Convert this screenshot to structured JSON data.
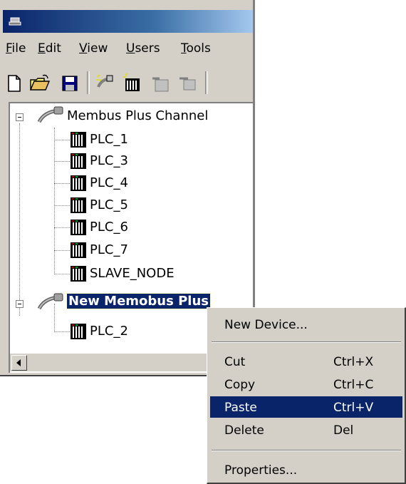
{
  "menubar": {
    "items": [
      {
        "label": "File",
        "mnemonic": "F",
        "rest": "ile"
      },
      {
        "label": "Edit",
        "mnemonic": "E",
        "rest": "dit"
      },
      {
        "label": "View",
        "mnemonic": "V",
        "rest": "iew"
      },
      {
        "label": "Users",
        "mnemonic": "U",
        "rest": "sers"
      },
      {
        "label": "Tools",
        "mnemonic": "T",
        "rest": "ools"
      }
    ]
  },
  "toolbar": {
    "buttons": [
      "new-file-icon",
      "open-folder-icon",
      "save-disk-icon",
      "new-channel-icon",
      "new-device-icon",
      "channel-properties-icon",
      "device-properties-icon"
    ]
  },
  "tree": {
    "channels": [
      {
        "label": "Membus Plus Channel",
        "devices": [
          "PLC_1",
          "PLC_3",
          "PLC_4",
          "PLC_5",
          "PLC_6",
          "PLC_7",
          "SLAVE_NODE"
        ]
      },
      {
        "label": "New Memobus Plus",
        "devices": [
          "PLC_2"
        ]
      }
    ]
  },
  "context_menu": {
    "new_device": "New Device...",
    "cut": {
      "label": "Cut",
      "shortcut": "Ctrl+X"
    },
    "copy": {
      "label": "Copy",
      "shortcut": "Ctrl+C"
    },
    "paste": {
      "label": "Paste",
      "shortcut": "Ctrl+V"
    },
    "delete": {
      "label": "Delete",
      "shortcut": "Del"
    },
    "properties": "Properties..."
  },
  "colors": {
    "title_bar": "#0a246a",
    "selection": "#0a246a",
    "chrome": "#d4d0c8"
  }
}
